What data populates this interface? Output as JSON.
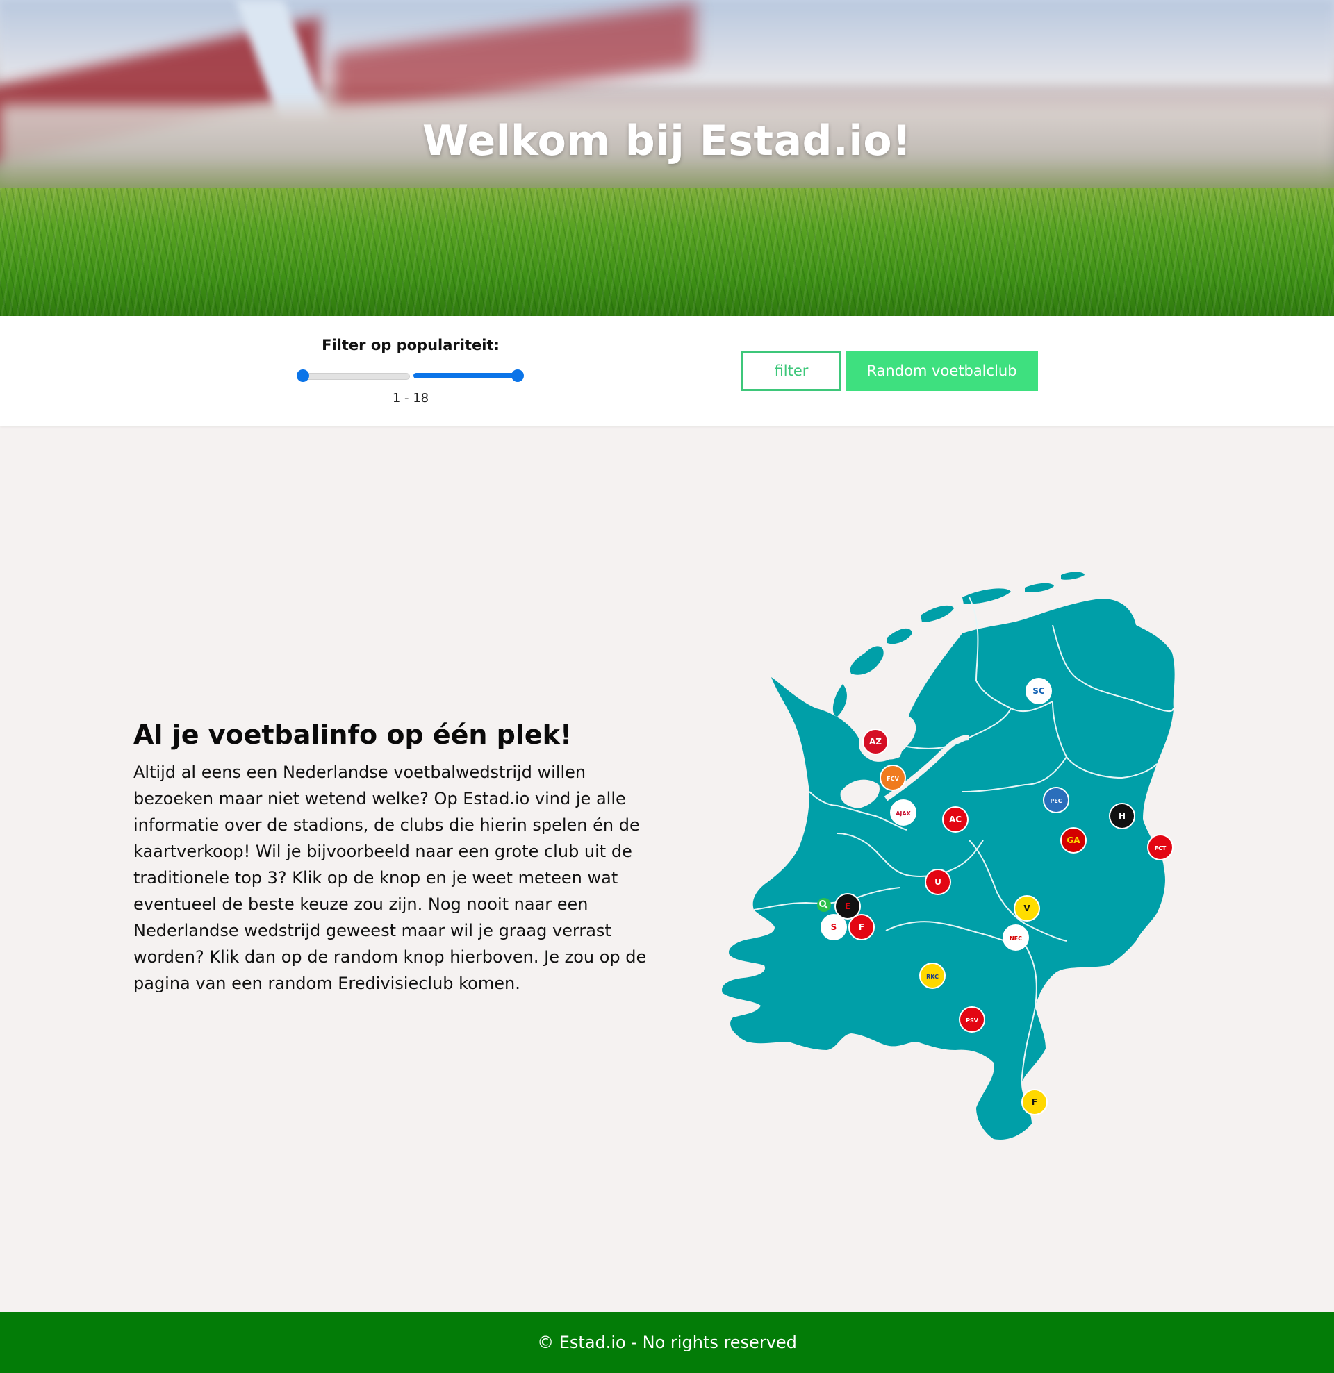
{
  "hero": {
    "title": "Welkom bij Estad.io!"
  },
  "filter": {
    "label": "Filter op populariteit:",
    "range_text": "1 - 18",
    "range_min": 1,
    "range_max": 18,
    "filter_button": "filter",
    "random_button": "Random voetbalclub"
  },
  "intro": {
    "title": "Al je voetbalinfo op één plek!",
    "text": "Altijd al eens een Nederlandse voetbalwedstrijd willen bezoeken maar niet wetend welke? Op Estad.io vind je alle informatie over de stadions, de clubs die hierin spelen én de kaartverkoop! Wil je bijvoorbeeld naar een grote club uit de traditionele top 3? Klik op de knop en je weet meteen wat eventueel de beste keuze zou zijn. Nog nooit naar een Nederlandse wedstrijd geweest maar wil je graag verrast worden? Klik dan op de random knop hierboven. Je zou op de pagina van een random Eredivisieclub komen."
  },
  "map": {
    "fill_color": "#009fa8",
    "clubs": [
      {
        "name": "heerenveen-logo",
        "abbr": "SC",
        "bg": "#ffffff",
        "fg": "#1463b4"
      },
      {
        "name": "az-logo",
        "abbr": "AZ",
        "bg": "#d50f25",
        "fg": "#ffffff"
      },
      {
        "name": "volendam-logo",
        "abbr": "FCV",
        "bg": "#f07b1e",
        "fg": "#ffffff"
      },
      {
        "name": "ajax-logo",
        "abbr": "AJAX",
        "bg": "#ffffff",
        "fg": "#c8102e"
      },
      {
        "name": "almere-logo",
        "abbr": "AC",
        "bg": "#e30613",
        "fg": "#ffffff"
      },
      {
        "name": "pec-zwolle-logo",
        "abbr": "PEC",
        "bg": "#2a6ebb",
        "fg": "#ffffff"
      },
      {
        "name": "heracles-logo",
        "abbr": "H",
        "bg": "#111111",
        "fg": "#ffffff"
      },
      {
        "name": "go-ahead-logo",
        "abbr": "GA",
        "bg": "#d40000",
        "fg": "#ffdd00"
      },
      {
        "name": "twente-logo",
        "abbr": "FCT",
        "bg": "#e30613",
        "fg": "#ffffff"
      },
      {
        "name": "utrecht-logo",
        "abbr": "U",
        "bg": "#e30613",
        "fg": "#ffffff"
      },
      {
        "name": "excelsior-logo",
        "abbr": "E",
        "bg": "#111111",
        "fg": "#e30613"
      },
      {
        "name": "sparta-logo",
        "abbr": "S",
        "bg": "#ffffff",
        "fg": "#e30613"
      },
      {
        "name": "feyenoord-logo",
        "abbr": "F",
        "bg": "#e30613",
        "fg": "#ffffff"
      },
      {
        "name": "vitesse-logo",
        "abbr": "V",
        "bg": "#ffdd00",
        "fg": "#111111"
      },
      {
        "name": "nec-logo",
        "abbr": "NEC",
        "bg": "#ffffff",
        "fg": "#d40000"
      },
      {
        "name": "rkc-logo",
        "abbr": "RKC",
        "bg": "#ffd800",
        "fg": "#1b3a8a"
      },
      {
        "name": "psv-logo",
        "abbr": "PSV",
        "bg": "#e30613",
        "fg": "#ffffff"
      },
      {
        "name": "fortuna-logo",
        "abbr": "F",
        "bg": "#ffd800",
        "fg": "#111111"
      }
    ]
  },
  "footer": {
    "text": "© Estad.io - No rights reserved"
  },
  "colors": {
    "accent_green": "#3ee07f",
    "slider_blue": "#0b74e8",
    "footer_green": "#037c07",
    "background": "#f5f2f1"
  }
}
